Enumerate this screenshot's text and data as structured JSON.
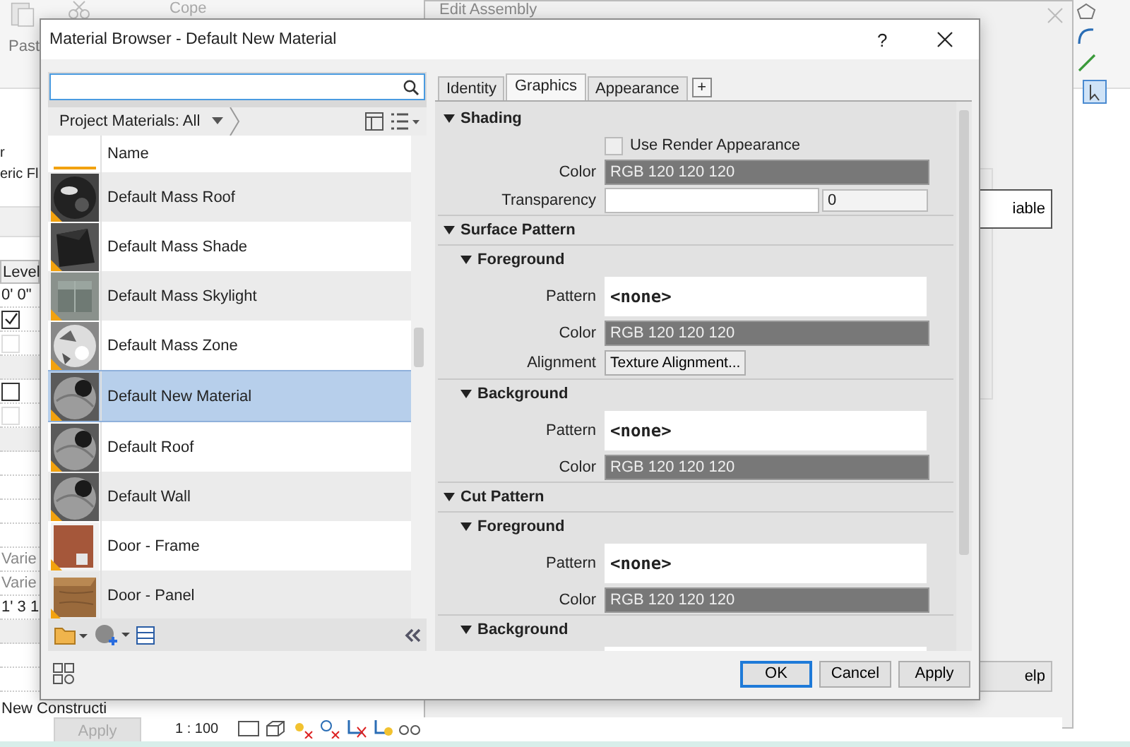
{
  "background": {
    "ribbon": {
      "paste_label": "Past",
      "cope_label": "Cope"
    },
    "assembly_dialog": {
      "title": "Edit Assembly",
      "side_button": "iable",
      "help_button": "elp"
    },
    "properties": {
      "lines": [
        "r",
        "eric Fl"
      ],
      "rows": [
        {
          "kind": "header",
          "text": "Level"
        },
        {
          "kind": "value",
          "text": "0'  0\"",
          "disabled": false
        },
        {
          "kind": "checkbox",
          "checked": true,
          "disabled": false
        },
        {
          "kind": "checkbox",
          "checked": false,
          "disabled": true
        },
        {
          "kind": "band"
        },
        {
          "kind": "checkbox",
          "checked": false,
          "disabled": false
        },
        {
          "kind": "checkbox",
          "checked": false,
          "disabled": true
        },
        {
          "kind": "band"
        },
        {
          "kind": "blank"
        },
        {
          "kind": "blank"
        },
        {
          "kind": "blank"
        },
        {
          "kind": "blank"
        },
        {
          "kind": "value",
          "text": "Varie",
          "disabled": true
        },
        {
          "kind": "value",
          "text": "Varie",
          "disabled": true
        },
        {
          "kind": "value",
          "text": "1'  3 1",
          "disabled": false
        },
        {
          "kind": "band"
        },
        {
          "kind": "blank"
        },
        {
          "kind": "blank"
        },
        {
          "kind": "blank"
        }
      ],
      "phase": "New Constructi",
      "apply": "Apply"
    },
    "status_bar": {
      "scale": "1 : 100"
    }
  },
  "dialog": {
    "title": "Material Browser - Default New Material",
    "help": "?",
    "browser": {
      "filter": "Project Materials: All",
      "column": "Name",
      "materials": [
        {
          "name": "Default Mass Roof",
          "selected": false
        },
        {
          "name": "Default Mass Shade",
          "selected": false
        },
        {
          "name": "Default Mass Skylight",
          "selected": false
        },
        {
          "name": "Default Mass Zone",
          "selected": false
        },
        {
          "name": "Default New Material",
          "selected": true
        },
        {
          "name": "Default Roof",
          "selected": false
        },
        {
          "name": "Default Wall",
          "selected": false
        },
        {
          "name": "Door - Frame",
          "selected": false
        },
        {
          "name": "Door - Panel",
          "selected": false
        }
      ]
    },
    "tabs": [
      {
        "label": "Identity",
        "selected": false
      },
      {
        "label": "Graphics",
        "selected": true
      },
      {
        "label": "Appearance",
        "selected": false
      }
    ],
    "add_tab": "+",
    "rows": [
      {
        "kind": "section",
        "label": "Shading"
      },
      {
        "kind": "checkbox",
        "label": "Use Render Appearance",
        "checked": false
      },
      {
        "kind": "color",
        "label": "Color",
        "value": "RGB 120 120 120"
      },
      {
        "kind": "slider",
        "label": "Transparency",
        "reading": "0"
      },
      {
        "kind": "section",
        "label": "Surface Pattern"
      },
      {
        "kind": "subsection",
        "label": "Foreground"
      },
      {
        "kind": "pattern",
        "label": "Pattern",
        "value": "<none>"
      },
      {
        "kind": "color",
        "label": "Color",
        "value": "RGB 120 120 120"
      },
      {
        "kind": "button",
        "label": "Alignment",
        "value": "Texture Alignment..."
      },
      {
        "kind": "subsection",
        "label": "Background"
      },
      {
        "kind": "pattern",
        "label": "Pattern",
        "value": "<none>"
      },
      {
        "kind": "color",
        "label": "Color",
        "value": "RGB 120 120 120"
      },
      {
        "kind": "section",
        "label": "Cut Pattern"
      },
      {
        "kind": "subsection",
        "label": "Foreground"
      },
      {
        "kind": "pattern",
        "label": "Pattern",
        "value": "<none>"
      },
      {
        "kind": "color",
        "label": "Color",
        "value": "RGB 120 120 120"
      },
      {
        "kind": "subsection",
        "label": "Background"
      },
      {
        "kind": "blank_pattern"
      }
    ],
    "buttons": [
      {
        "label": "OK",
        "kind": "default"
      },
      {
        "label": "Cancel",
        "kind": "normal"
      },
      {
        "label": "Apply",
        "kind": "normal"
      }
    ]
  }
}
